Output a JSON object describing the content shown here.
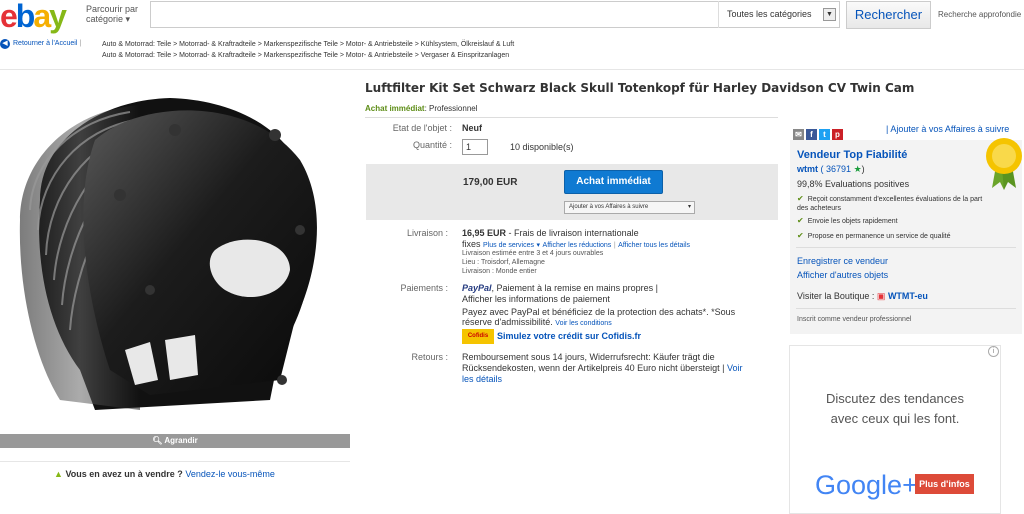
{
  "header": {
    "logo": "ebay",
    "browse_line1": "Parcourir par",
    "browse_line2": "catégorie",
    "search_placeholder": "",
    "category_select": "Toutes les catégories",
    "search_button": "Rechercher",
    "advanced_link": "Recherche approfondie"
  },
  "breadcrumb": {
    "back": "Retourner à l'Accueil",
    "line1": "Auto & Motorrad: Teile > Motorrad- & Kraftradteile > Markenspezifische Teile > Motor- & Antriebsteile > Kühlsystem, Ölkreislauf & Luft",
    "line2": "Auto & Motorrad: Teile > Motorrad- & Kraftradteile > Markenspezifische Teile > Motor- & Antriebsteile > Vergaser & Einspritzanlagen"
  },
  "item": {
    "title": "Luftfilter Kit Set Schwarz Black Skull Totenkopf für Harley Davidson CV Twin Cam",
    "format_label": "Achat immédiat",
    "format_suffix": ": Professionnel",
    "condition_label": "Etat de l'objet :",
    "condition": "Neuf",
    "quantity_label": "Quantité :",
    "quantity": "1",
    "available": "10 disponible(s)",
    "price": "179,00 EUR",
    "buy_button": "Achat immédiat",
    "watch_button": "Ajouter à vos Affaires à suivre",
    "zoom": "Agrandir"
  },
  "shipping": {
    "label": "Livraison :",
    "cost": "16,95 EUR",
    "desc": "- Frais de livraison internationale",
    "fixes": "fixes",
    "more_services": "Plus de services",
    "show_reductions": "Afficher les réductions",
    "show_all": "Afficher tous les détails",
    "estimate": "Livraison estimée entre 3 et 4 jours ouvrables",
    "location": "Lieu : Troisdorf, Allemagne",
    "ships_to": "Livraison : Monde entier"
  },
  "payments": {
    "label": "Paiements :",
    "paypal": "PayPal",
    "paypal_text": ", Paiement à la remise en mains propres |",
    "show_info": "Afficher les informations de paiement",
    "paypal_protect": "Payez avec PayPal et bénéficiez de la protection des achats*. *Sous réserve d'admissibilité.",
    "see_conditions": "Voir les conditions",
    "cofidis_badge": "Cofidis",
    "cofidis_link": "Simulez votre crédit sur Cofidis.fr"
  },
  "returns": {
    "label": "Retours :",
    "text": "Remboursement sous 14 jours, Widerrufsrecht: Käufer trägt die Rücksendekosten, wenn der Artikelpreis 40 Euro nicht übersteigt |",
    "link": "Voir les détails"
  },
  "sell": {
    "question": "Vous en avez un à vendre ?",
    "link": "Vendez-le vous-même"
  },
  "seller": {
    "add_watch": "| Ajouter à vos Affaires à suivre",
    "title": "Vendeur Top Fiabilité",
    "name": "wtmt",
    "feedback": "( 36791",
    "positive": "99,8% Evaluations positives",
    "bullet1": "Reçoit constamment d'excellentes évaluations de la part des acheteurs",
    "bullet2": "Envoie les objets rapidement",
    "bullet3": "Propose en permanence un service de qualité",
    "save_seller": "Enregistrer ce vendeur",
    "other_items": "Afficher d'autres objets",
    "store_label": "Visiter la Boutique :",
    "store": "WTMT-eu",
    "registered": "Inscrit comme vendeur professionnel"
  },
  "ad": {
    "line1": "Discutez des tendances",
    "line2": "avec ceux qui les font.",
    "brand": "Google+",
    "button": "Plus d'infos"
  }
}
